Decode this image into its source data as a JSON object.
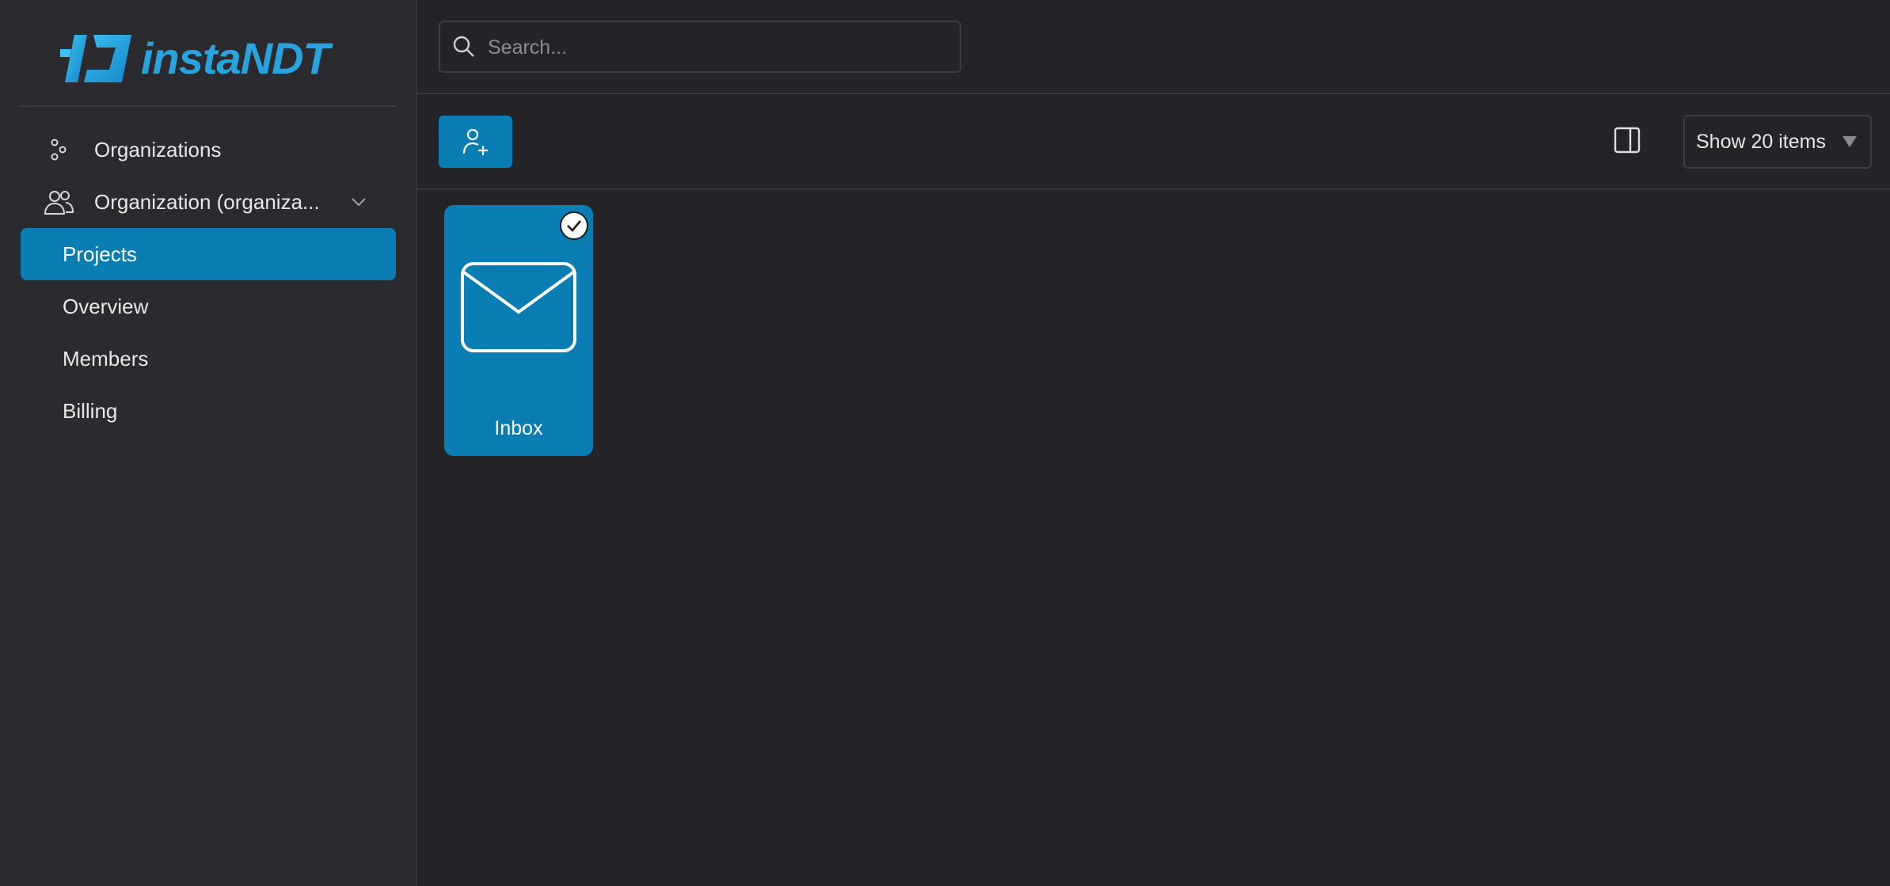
{
  "brand": {
    "name": "instaNDT",
    "accent": "#29a3dd"
  },
  "sidebar": {
    "items": [
      {
        "label": "Organizations",
        "icon": "organizations-icon"
      },
      {
        "label": "Organization (organiza...",
        "icon": "users-icon"
      },
      {
        "label": "Projects",
        "active": true
      },
      {
        "label": "Overview"
      },
      {
        "label": "Members"
      },
      {
        "label": "Billing"
      }
    ]
  },
  "search": {
    "placeholder": "Search...",
    "value": ""
  },
  "toolbar": {
    "add_user_icon": "user-plus-icon",
    "panel_icon": "panel-right-icon",
    "show_items_label": "Show 20 items"
  },
  "grid": {
    "items": [
      {
        "label": "Inbox",
        "icon": "envelope-icon",
        "selected": true
      }
    ]
  },
  "colors": {
    "background": "#232328",
    "sidebar": "#2a2a2f",
    "primary": "#0a7db3",
    "border": "#35353b"
  }
}
